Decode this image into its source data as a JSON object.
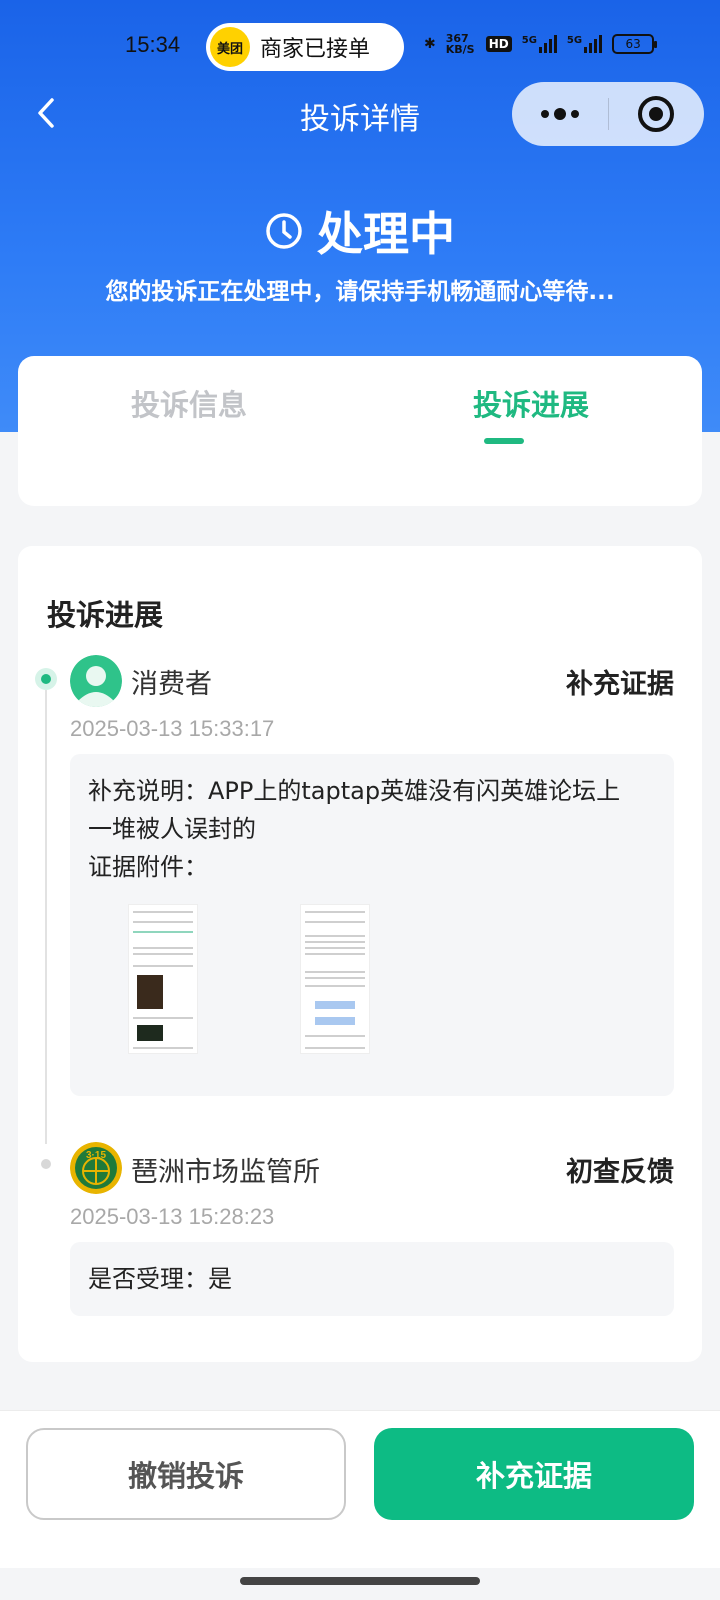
{
  "status_bar": {
    "time": "15:34",
    "notification_logo": "美团",
    "notification_text": "商家已接单",
    "net_speed": "367 KB/S",
    "hd_label": "HD",
    "network_1": "5G",
    "network_2": "5G",
    "battery": "63"
  },
  "nav": {
    "title": "投诉详情"
  },
  "header": {
    "status_title": "处理中",
    "status_desc": "您的投诉正在处理中，请保持手机畅通耐心等待..."
  },
  "tabs": [
    {
      "label": "投诉信息",
      "active": false
    },
    {
      "label": "投诉进展",
      "active": true
    }
  ],
  "progress": {
    "section_title": "投诉进展",
    "entries": [
      {
        "actor": "消费者",
        "action": "补充证据",
        "timestamp": "2025-03-13 15:33:17",
        "lines": [
          "补充说明：APP上的taptap英雄没有闪英雄论坛上",
          "一堆被人误封的",
          "证据附件："
        ],
        "attachments": 2
      },
      {
        "actor": "琶洲市场监管所",
        "action": "初查反馈",
        "timestamp": "2025-03-13 15:28:23",
        "lines": [
          "是否受理：是"
        ]
      }
    ]
  },
  "buttons": {
    "cancel": "撤销投诉",
    "supplement": "补充证据"
  },
  "colors": {
    "brand_blue": "#1a63e8",
    "accent_green": "#1fb981",
    "button_green": "#0dbb84"
  }
}
